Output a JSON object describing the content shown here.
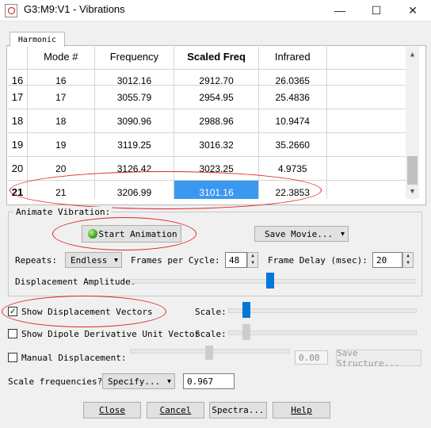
{
  "window": {
    "title": "G3:M9:V1 - Vibrations",
    "minimize_glyph": "—",
    "maximize_glyph": "☐",
    "close_glyph": "✕"
  },
  "tab": {
    "label": "Harmonic"
  },
  "table": {
    "headers": [
      "Mode #",
      "Frequency",
      "Scaled Freq",
      "Infrared"
    ],
    "rows": [
      {
        "row": "16",
        "mode": "16",
        "freq": "3012.16",
        "scaled": "2912.70",
        "ir": "26.0365"
      },
      {
        "row": "17",
        "mode": "17",
        "freq": "3055.79",
        "scaled": "2954.95",
        "ir": "25.4836"
      },
      {
        "row": "18",
        "mode": "18",
        "freq": "3090.96",
        "scaled": "2988.96",
        "ir": "10.9474"
      },
      {
        "row": "19",
        "mode": "19",
        "freq": "3119.25",
        "scaled": "3016.32",
        "ir": "35.2660"
      },
      {
        "row": "20",
        "mode": "20",
        "freq": "3126.42",
        "scaled": "3023.25",
        "ir": "4.9735"
      },
      {
        "row": "21",
        "mode": "21",
        "freq": "3206.99",
        "scaled": "3101.16",
        "ir": "22.3853"
      }
    ],
    "selected_row": "21",
    "selection_color": "#3a98f0",
    "scroll_up": "▲",
    "scroll_down": "▼"
  },
  "animate": {
    "group_label": "Animate Vibration:",
    "start_button": "Start Animation",
    "save_movie": "Save Movie...",
    "repeats_label": "Repeats:",
    "repeats_value": "Endless",
    "fpc_label": "Frames per Cycle:",
    "fpc_value": "48",
    "delay_label": "Frame Delay (msec):",
    "delay_value": "20",
    "amplitude_label": "Displacement Amplitude:",
    "amplitude_level": 0.5
  },
  "options": {
    "show_disp_vectors": "Show Displacement Vectors",
    "show_disp_checked": "✓",
    "scale_label": "Scale:",
    "show_dipole": "Show Dipole Derivative Unit Vector",
    "manual_disp": "Manual Displacement:",
    "manual_value": "0.00",
    "save_structure": "Save Structure...",
    "scale_freq_label": "Scale frequencies?",
    "specify": "Specify...",
    "scale_factor": "0.967"
  },
  "footer": {
    "close": "Close",
    "cancel": "Cancel",
    "spectra": "Spectra...",
    "help": "Help"
  },
  "colors": {
    "accent": "#0078d7",
    "annotation": "#e0252b"
  }
}
